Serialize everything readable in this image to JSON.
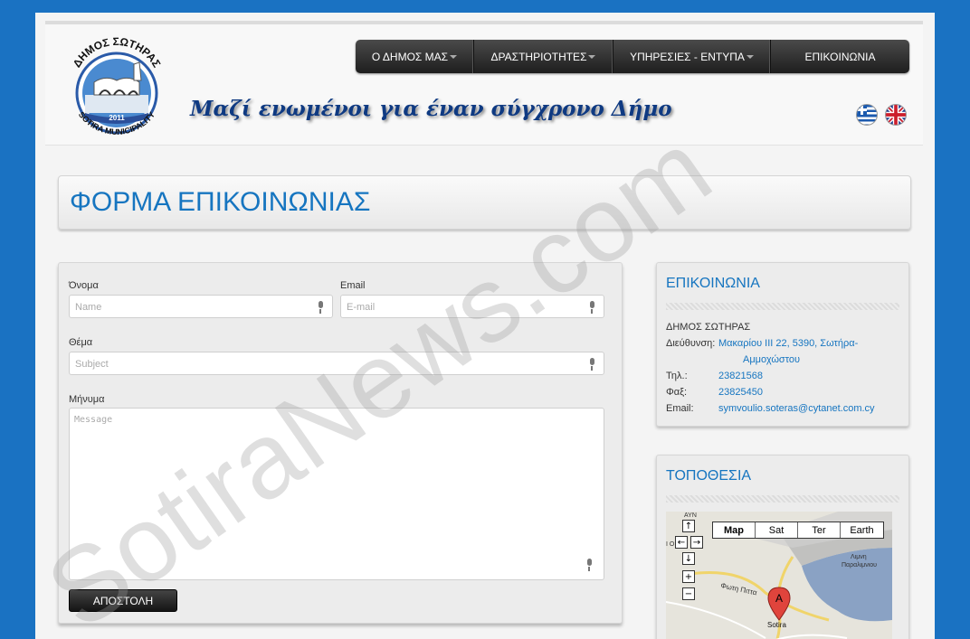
{
  "header": {
    "logo_text_top": "ΔΗΜΟΣ ΣΩΤΗΡΑΣ",
    "logo_text_bottom": "SOTIRA MUNICIPALITY",
    "logo_year": "2011",
    "slogan": "Μαζί ενωμένοι για έναν σύγχρονο Δήμο"
  },
  "nav": {
    "items": [
      {
        "label": "Ο ΔΗΜΟΣ ΜΑΣ",
        "has_caret": true
      },
      {
        "label": "ΔΡΑΣΤΗΡΙΟΤΗΤΕΣ",
        "has_caret": true
      },
      {
        "label": "ΥΠΗΡΕΣΙΕΣ - ΕΝΤΥΠΑ",
        "has_caret": true
      },
      {
        "label": "ΕΠΙΚΟΙΝΩΝΙΑ",
        "has_caret": false
      }
    ]
  },
  "page_title": "ΦΟΡΜΑ ΕΠΙΚΟΙΝΩΝΙΑΣ",
  "form": {
    "name_label": "Όνομα",
    "name_placeholder": "Name",
    "email_label": "Email",
    "email_placeholder": "E-mail",
    "subject_label": "Θέμα",
    "subject_placeholder": "Subject",
    "message_label": "Μήνυμα",
    "message_placeholder": "Message",
    "submit_label": "ΑΠΟΣΤΟΛΗ"
  },
  "contact": {
    "title": "ΕΠΙΚΟΙΝΩΝΙΑ",
    "org": "ΔΗΜΟΣ ΣΩΤΗΡΑΣ",
    "address_label": "Διεύθυνση:",
    "address_line1": "Μακαρίου ΙΙΙ 22, 5390, Σωτήρα-",
    "address_line2": "Αμμοχώστου",
    "phone_label": "Τηλ.:",
    "phone": "23821568",
    "fax_label": "Φαξ:",
    "fax": "23825450",
    "email_label": "Email:",
    "email": "symvoulio.soteras@cytanet.com.cy"
  },
  "location": {
    "title": "ΤΟΠΟΘΕΣΙΑ",
    "map_buttons": [
      "Map",
      "Sat",
      "Ter",
      "Earth"
    ],
    "map_marker": "A",
    "map_label_town": "Sotira",
    "map_label_road": "Φωτη Πιττα",
    "map_label_lake1": "Λιμνη",
    "map_label_lake2": "Παραλιμνιου",
    "map_label_top": "ΑΥΝ",
    "map_label_left": "Ι Ο"
  },
  "watermark": "SotiraNews.com",
  "colors": {
    "background": "#1a72c2",
    "accent": "#1675c0",
    "slogan": "#0f3a82"
  }
}
